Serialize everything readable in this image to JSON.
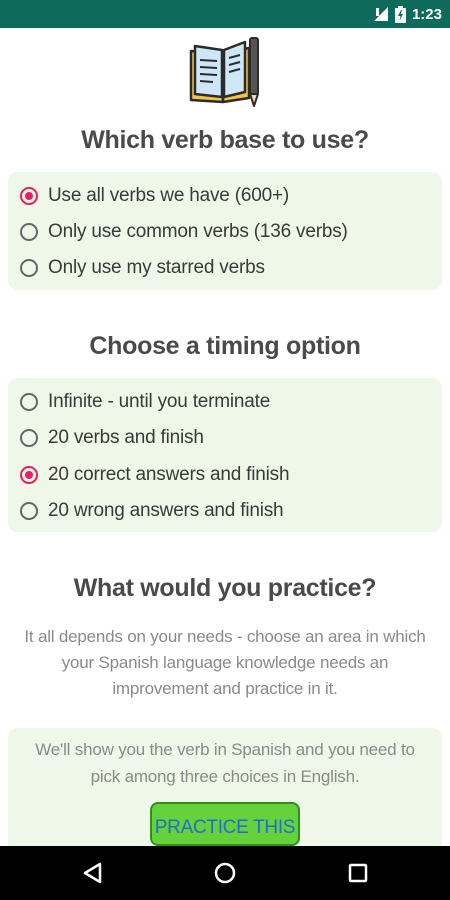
{
  "status_bar": {
    "time": "1:23",
    "background_color": "#0e6b5c"
  },
  "header": {
    "icon": "book-pen-icon"
  },
  "verb_base": {
    "title": "Which verb base to use?",
    "options": [
      {
        "label": "Use all verbs we have (600+)",
        "selected": true
      },
      {
        "label": "Only use common verbs (136 verbs)",
        "selected": false
      },
      {
        "label": "Only use my starred verbs",
        "selected": false
      }
    ]
  },
  "timing": {
    "title": "Choose a timing option",
    "options": [
      {
        "label": "Infinite - until you terminate",
        "selected": false
      },
      {
        "label": "20 verbs and finish",
        "selected": false
      },
      {
        "label": "20 correct answers and finish",
        "selected": true
      },
      {
        "label": "20 wrong answers and finish",
        "selected": false
      }
    ]
  },
  "practice": {
    "title": "What would you practice?",
    "description": "It all depends on your needs - choose an area in which your Spanish language knowledge needs an improvement and practice in it.",
    "cards": [
      {
        "text": "We'll show you the verb in Spanish and you need to pick among three choices in English.",
        "button_label": "PRACTICE THIS"
      }
    ]
  },
  "nav_bar": {
    "back_icon": "back-triangle-icon",
    "home_icon": "home-circle-icon",
    "recents_icon": "recents-square-icon"
  },
  "colors": {
    "accent": "#e91e63",
    "panel_bg": "#eef7e8",
    "button_bg": "#65d13b",
    "button_text": "#1f6fd1"
  }
}
